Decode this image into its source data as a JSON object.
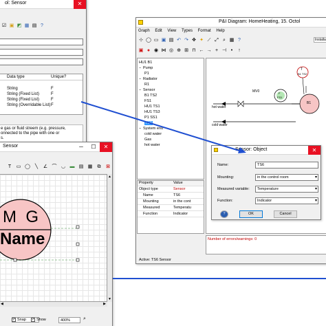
{
  "left_window": {
    "title": "ol: Sensor",
    "table_headers": [
      "Data type",
      "Unique?"
    ],
    "rows": [
      [
        "String",
        "F"
      ],
      [
        "String (Fixed List)",
        "F"
      ],
      [
        "String (Fixed List)",
        "F"
      ],
      [
        "String (Overridable List)",
        "F"
      ]
    ],
    "description_lines": [
      "e gas or fluid streem (e.g. pressure,",
      "onnected to the pipe with one or",
      "s."
    ]
  },
  "symbol_window": {
    "title": "Sensor",
    "symbol_top_text": "M  G",
    "symbol_name_text": "Name",
    "snap_label": "Snap",
    "show_label": "Show",
    "zoom": "400%"
  },
  "main_window": {
    "title": "P&I Diagram: HomeHeating, 15. Octol",
    "menu": [
      "Graph",
      "Edit",
      "View",
      "Types",
      "Format",
      "Help"
    ],
    "install_label": "Installa",
    "tree": [
      {
        "label": "HU1 B1",
        "indent": 0,
        "expander": ""
      },
      {
        "label": "Pump",
        "indent": 0,
        "expander": "−"
      },
      {
        "label": "P1",
        "indent": 1,
        "expander": ""
      },
      {
        "label": "Radiator",
        "indent": 0,
        "expander": "−"
      },
      {
        "label": "R1",
        "indent": 1,
        "expander": ""
      },
      {
        "label": "Sensor",
        "indent": 0,
        "expander": "−"
      },
      {
        "label": "B1 TS2",
        "indent": 1,
        "expander": ""
      },
      {
        "label": "FS1",
        "indent": 1,
        "expander": ""
      },
      {
        "label": "HU1 TS1",
        "indent": 1,
        "expander": ""
      },
      {
        "label": "HU1 TS3",
        "indent": 1,
        "expander": ""
      },
      {
        "label": "P1 SS1",
        "indent": 1,
        "expander": ""
      },
      {
        "label": "TS6",
        "indent": 1,
        "expander": "",
        "selected": true
      },
      {
        "label": "System end",
        "indent": 0,
        "expander": "−"
      },
      {
        "label": "cold water",
        "indent": 1,
        "expander": ""
      },
      {
        "label": "Gas",
        "indent": 1,
        "expander": ""
      },
      {
        "label": "hot water",
        "indent": 1,
        "expander": ""
      }
    ],
    "property_headers": [
      "Property",
      "Value"
    ],
    "properties": [
      {
        "name": "Object type",
        "value": "Sensor",
        "value_red": true
      },
      {
        "name": "Name",
        "value": "TS6",
        "value_red": false
      },
      {
        "name": "Mounting",
        "value": "in the cont",
        "value_red": false
      },
      {
        "name": "Measured",
        "value": "Temperatu",
        "value_red": false
      },
      {
        "name": "Function",
        "value": "Indicator",
        "value_red": false
      }
    ],
    "diagram_labels": {
      "mv": "MV0",
      "fi_top": "F",
      "fi_bottom": "FS1",
      "tc_top": "T",
      "tc_bottom": "B1 TS2",
      "b1": "B1",
      "hot_water": "hot water",
      "cold_water": "cold water"
    },
    "errors_text": "Number of errors/warnings: 0",
    "active_text": "Active: TS6 Sensor"
  },
  "dialog": {
    "title": "Sensor: Object",
    "fields": [
      {
        "label": "Name:",
        "value": "TS6",
        "combo": false
      },
      {
        "label": "Mounting:",
        "value": "in the control room",
        "combo": true
      },
      {
        "label": "Measured variable:",
        "value": "Temperature",
        "combo": true
      },
      {
        "label": "Function:",
        "value": "Indicator",
        "combo": true
      }
    ],
    "help_label": "?",
    "ok_label": "OK",
    "cancel_label": "Cancel",
    "close_label": "✕"
  },
  "colors": {
    "arrow": "#1f4fd1",
    "selection": "#3399ff",
    "close_red": "#e81123",
    "error_red": "#c00000",
    "sensor_pink": "#f7c5c5"
  }
}
